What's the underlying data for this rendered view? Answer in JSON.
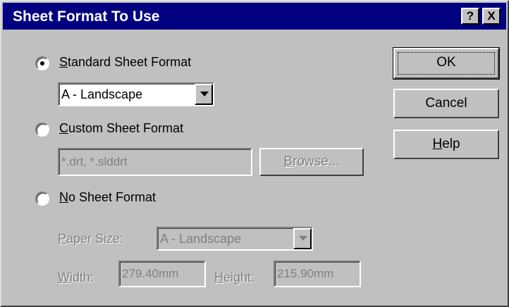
{
  "window": {
    "title": "Sheet Format To Use",
    "help_glyph": "?",
    "close_glyph": "X"
  },
  "options": {
    "standard": {
      "label_first": "S",
      "label_rest": "tandard Sheet Format",
      "selected": true
    },
    "standard_select": {
      "value": "A - Landscape"
    },
    "custom": {
      "label_first": "C",
      "label_rest": "ustom Sheet Format",
      "selected": false
    },
    "custom_field": {
      "value": "*.drt, *.slddrt"
    },
    "browse": {
      "label_first": "B",
      "label_rest": "rowse..."
    },
    "none": {
      "label_first": "N",
      "label_rest": "o Sheet Format",
      "selected": false
    }
  },
  "paper": {
    "size_label_first": "P",
    "size_label_rest": "aper Size:",
    "size_value": "A - Landscape",
    "width_label_first": "W",
    "width_label_rest": "idth:",
    "width_value": "279.40mm",
    "height_label_first": "H",
    "height_label_rest": "eight:",
    "height_value": "215.90mm"
  },
  "buttons": {
    "ok": "OK",
    "cancel": "Cancel",
    "help_first": "H",
    "help_rest": "elp"
  }
}
